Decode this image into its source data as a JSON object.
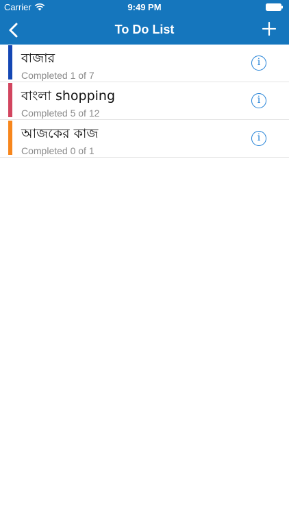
{
  "status_bar": {
    "carrier": "Carrier",
    "time": "9:49 PM"
  },
  "nav": {
    "title": "To Do List",
    "back_icon": "chevron-left-icon",
    "add_icon": "plus-icon"
  },
  "lists": [
    {
      "title": "বাজার",
      "subtitle": "Completed 1 of 7",
      "color": "#1447b4"
    },
    {
      "title": "বাংলা shopping",
      "subtitle": "Completed 5 of 12",
      "color": "#d2455f"
    },
    {
      "title": "আজকের কাজ",
      "subtitle": "Completed 0 of 1",
      "color": "#f7861c"
    }
  ],
  "info_glyph": "i",
  "colors": {
    "header": "#1576bd",
    "accent": "#1e7fd6"
  }
}
